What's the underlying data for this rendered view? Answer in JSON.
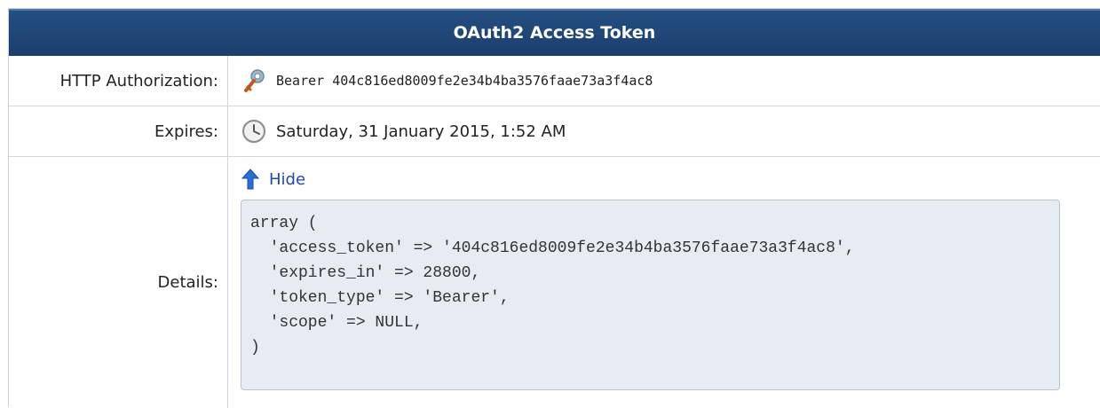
{
  "panel": {
    "title": "OAuth2 Access Token"
  },
  "rows": {
    "authorization": {
      "label": "HTTP Authorization:",
      "value": "Bearer 404c816ed8009fe2e34b4ba3576faae73a3f4ac8",
      "icon": "key-icon"
    },
    "expires": {
      "label": "Expires:",
      "value": "Saturday, 31 January 2015, 1:52 AM",
      "icon": "clock-icon"
    },
    "details": {
      "label": "Details:",
      "toggle_label": "Hide",
      "toggle_icon": "arrow-up-icon",
      "code_lines": [
        "array (",
        "  'access_token' => '404c816ed8009fe2e34b4ba3576faae73a3f4ac8',",
        "  'expires_in' => 28800,",
        "  'token_type' => 'Bearer',",
        "  'scope' => NULL,",
        ")"
      ]
    }
  },
  "colors": {
    "header_bg": "#1f4676",
    "code_bg": "#e7ecf3",
    "link": "#1f4aa8"
  }
}
